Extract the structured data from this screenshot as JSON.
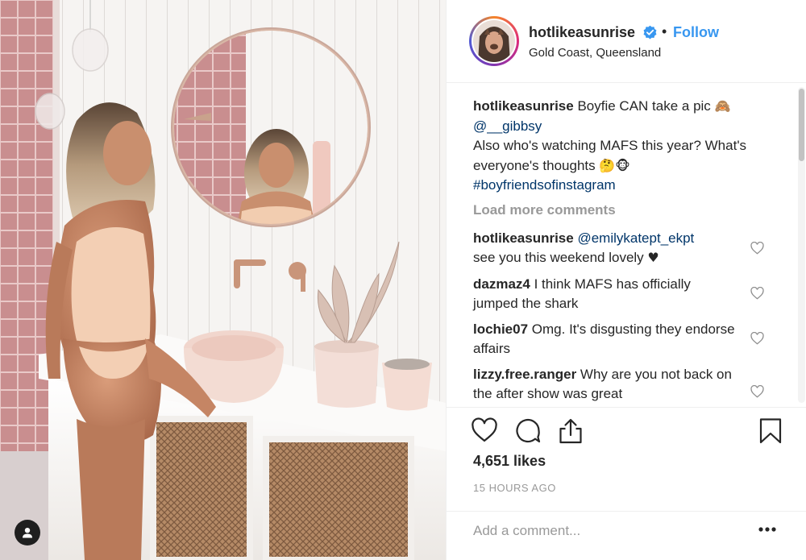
{
  "post": {
    "username": "hotlikeasunrise",
    "follow_label": "Follow",
    "separator": "•",
    "location": "Gold Coast, Queensland"
  },
  "caption": {
    "username": "hotlikeasunrise",
    "text_1": "Boyfie CAN take a pic",
    "emoji_1": "🙈",
    "mention": "@__gibbsy",
    "text_2": "Also who's watching MAFS this year? What's everyone's thoughts",
    "emoji_2": "🤔🐵",
    "hashtag": "#boyfriendsofinstagram"
  },
  "load_more_label": "Load more comments",
  "comments": [
    {
      "username": "hotlikeasunrise",
      "mention": "@emilykatept_ekpt",
      "text": "see you this weekend lovely",
      "emoji": "♥"
    },
    {
      "username": "dazmaz4",
      "text": "I think MAFS has officially jumped the shark"
    },
    {
      "username": "lochie07",
      "text": "Omg. It's disgusting they endorse affairs"
    },
    {
      "username": "lizzy.free.ranger",
      "text": "Why are you not back on the after show was great"
    }
  ],
  "likes": "4,651 likes",
  "timestamp": "15 HOURS AGO",
  "add_comment": {
    "placeholder": "Add a comment..."
  },
  "colors": {
    "accent_blue": "#3897f0",
    "link_navy": "#003569",
    "muted_gray": "#999999",
    "text": "#262626",
    "tile_pink": "#c98e8f",
    "bathroom_wall": "#f4f1ee"
  },
  "icons": [
    "verified-badge-icon",
    "heart-icon",
    "comment-icon",
    "share-icon",
    "bookmark-icon",
    "more-options-icon",
    "user-tag-icon"
  ]
}
